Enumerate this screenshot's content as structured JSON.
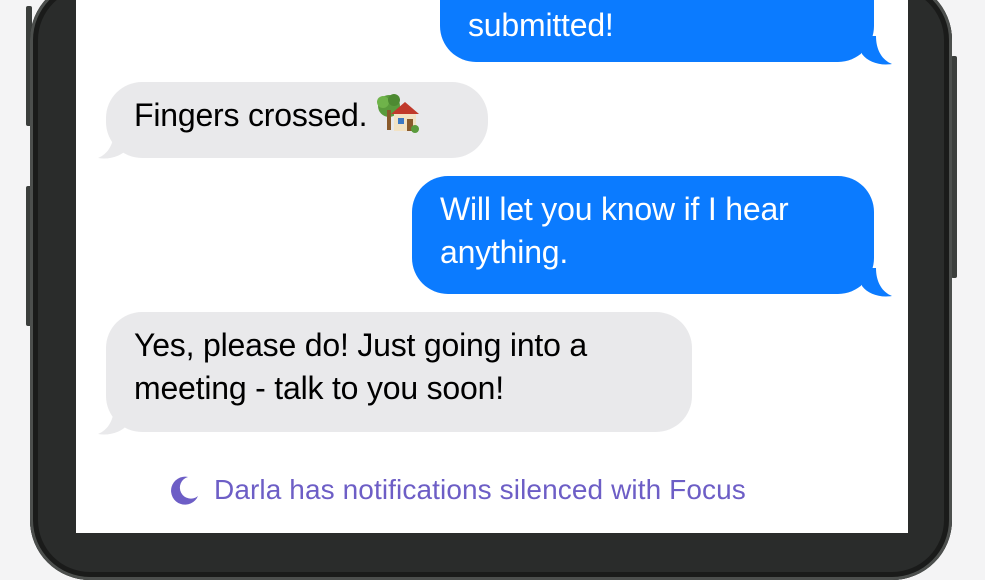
{
  "conversation": {
    "messages": [
      {
        "direction": "outgoing",
        "lines": [
          "submitted!"
        ]
      },
      {
        "direction": "incoming",
        "lines": [
          "Fingers crossed."
        ],
        "emoji": "house-with-garden-icon"
      },
      {
        "direction": "outgoing",
        "lines": [
          "Will let you know if I hear",
          "anything."
        ]
      },
      {
        "direction": "incoming",
        "lines": [
          "Yes, please do! Just going into a",
          "meeting - talk to you soon!"
        ]
      }
    ],
    "focus_status": {
      "icon": "moon-icon",
      "text": "Darla has notifications silenced with Focus"
    }
  },
  "colors": {
    "outgoing_bubble": "#0b7bff",
    "incoming_bubble": "#e9e9eb",
    "focus_text": "#6d5ec6"
  }
}
